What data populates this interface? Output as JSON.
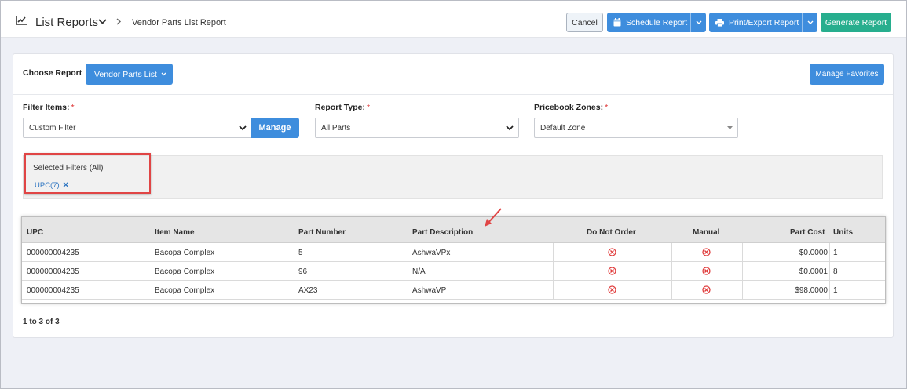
{
  "header": {
    "title": "List Reports",
    "breadcrumb": "Vendor Parts List Report",
    "cancel_label": "Cancel",
    "schedule_label": "Schedule Report",
    "print_label": "Print/Export Report",
    "generate_label": "Generate Report"
  },
  "report": {
    "choose_label": "Choose Report",
    "selected": "Vendor Parts List",
    "manage_favorites_label": "Manage Favorites"
  },
  "filters": {
    "filter_items_label": "Filter Items:",
    "filter_items_value": "Custom Filter",
    "manage_label": "Manage",
    "report_type_label": "Report Type:",
    "report_type_value": "All Parts",
    "pricebook_label": "Pricebook Zones:",
    "pricebook_value": "Default Zone",
    "required_mark": "*"
  },
  "selected_filters": {
    "title": "Selected Filters (All)",
    "chips": [
      "UPC(7)"
    ],
    "remove_glyph": "✕"
  },
  "table": {
    "columns": [
      "UPC",
      "Item Name",
      "Part Number",
      "Part Description",
      "Do Not Order",
      "Manual",
      "Part Cost",
      "Units"
    ],
    "rows": [
      {
        "upc": "000000004235",
        "item_name": "Bacopa Complex",
        "part_number": "5",
        "part_description": "AshwaVPx",
        "do_not_order": "no",
        "manual": "no",
        "part_cost": "$0.0000",
        "units": "1"
      },
      {
        "upc": "000000004235",
        "item_name": "Bacopa Complex",
        "part_number": "96",
        "part_description": "N/A",
        "do_not_order": "no",
        "manual": "no",
        "part_cost": "$0.0001",
        "units": "8"
      },
      {
        "upc": "000000004235",
        "item_name": "Bacopa Complex",
        "part_number": "AX23",
        "part_description": "AshwaVP",
        "do_not_order": "no",
        "manual": "no",
        "part_cost": "$98.0000",
        "units": "1"
      }
    ]
  },
  "pager": {
    "summary": "1 to 3 of 3"
  },
  "colors": {
    "primary": "#3e8ddd",
    "success": "#27ae8e",
    "danger": "#e04545",
    "x_icon": "#e03b3b"
  }
}
